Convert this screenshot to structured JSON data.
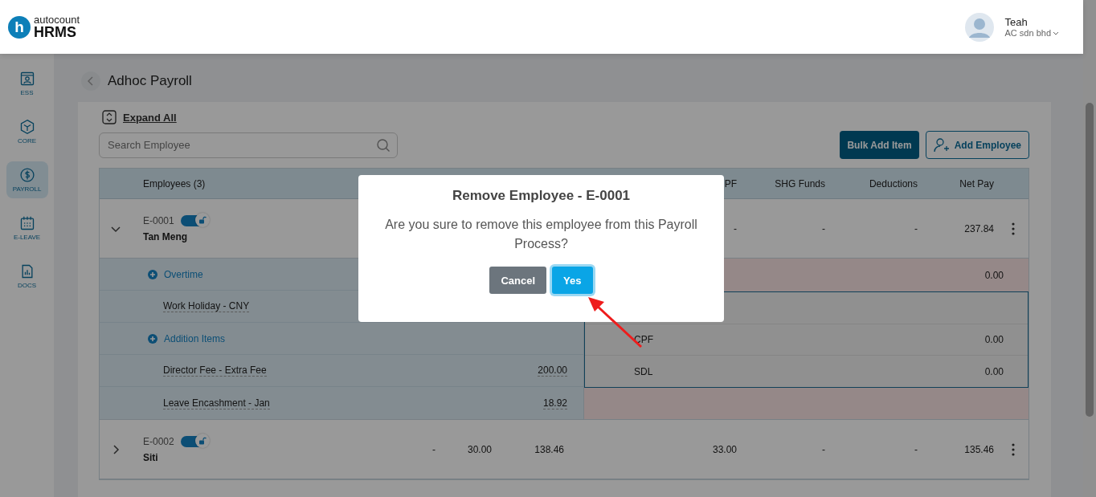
{
  "logo": {
    "mark": "h",
    "top": "autocount",
    "bottom": "HRMS"
  },
  "user": {
    "name": "Teah",
    "company": "AC sdn bhd"
  },
  "sidebar": {
    "items": [
      {
        "label": "ESS",
        "selected": false
      },
      {
        "label": "CORE",
        "selected": false
      },
      {
        "label": "PAYROLL",
        "selected": true
      },
      {
        "label": "E-LEAVE",
        "selected": false
      },
      {
        "label": "DOCS",
        "selected": false
      }
    ]
  },
  "page": {
    "title": "Adhoc Payroll"
  },
  "toolbar": {
    "expand_all": "Expand All",
    "search_placeholder": "Search Employee",
    "bulk_add": "Bulk Add Item",
    "add_employee": "Add Employee"
  },
  "table": {
    "employees_header": "Employees (3)",
    "columns": [
      "",
      "",
      "",
      "",
      "PF",
      "SHG Funds",
      "Deductions",
      "Net Pay"
    ],
    "rows": [
      {
        "id": "E-0001",
        "name": "Tan Meng",
        "on": true,
        "expanded": true,
        "cells": [
          "",
          "",
          "",
          "",
          "-",
          "-",
          "-",
          "237.84"
        ],
        "details": [
          {
            "kind": "group",
            "label": "Overtime"
          },
          {
            "kind": "item",
            "label": "Work Holiday - CNY"
          },
          {
            "kind": "group",
            "label": "Addition Items"
          },
          {
            "kind": "item",
            "label": "Director Fee - Extra Fee",
            "amount": "200.00"
          },
          {
            "kind": "item",
            "label": "Leave Encashment - Jan",
            "amount": "18.92"
          }
        ],
        "side": {
          "total": "0.00",
          "lines": [
            {
              "label": "CPF",
              "amount": "0.00"
            },
            {
              "label": "SDL",
              "amount": "0.00"
            }
          ]
        }
      },
      {
        "id": "E-0002",
        "name": "Siti",
        "on": true,
        "expanded": false,
        "cells": [
          "-",
          "30.00",
          "138.46",
          "",
          "33.00",
          "-",
          "-",
          "135.46"
        ]
      }
    ]
  },
  "dialog": {
    "title": "Remove Employee - E-0001",
    "message": "Are you sure to remove this employee from this Payroll Process?",
    "cancel": "Cancel",
    "confirm": "Yes"
  }
}
